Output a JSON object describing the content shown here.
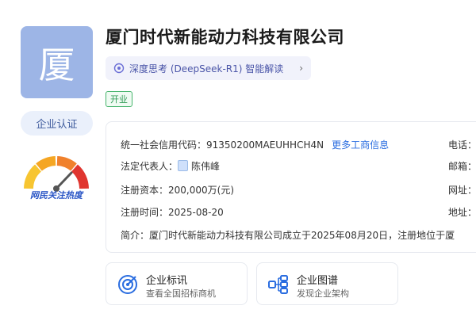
{
  "company": {
    "logo_char": "厦",
    "name": "厦门时代新能动力科技有限公司",
    "status": "开业",
    "cert_label": "企业认证"
  },
  "ai_button": {
    "label": "深度思考 (DeepSeek-R1) 智能解读",
    "chevron": "›"
  },
  "gauge": {
    "label": "网民关注热度",
    "level_fraction": 0.8
  },
  "info": {
    "credit_code_label": "统一社会信用代码：",
    "credit_code": "91350200MAEUHHCH4N",
    "more_link": "更多工商信息",
    "legal_rep_label": "法定代表人：",
    "legal_rep": "陈伟峰",
    "capital_label": "注册资本：",
    "capital": "200,000万(元)",
    "reg_date_label": "注册时间：",
    "reg_date": "2025-08-20",
    "intro_label": "简介：",
    "intro": "厦门时代新能动力科技有限公司成立于2025年08月20日，注册地位于厦",
    "right_labels": [
      "电话：",
      "邮箱：",
      "网址：",
      "地址："
    ]
  },
  "cards": [
    {
      "title": "企业标讯",
      "subtitle": "查看全国招标商机",
      "icon": "target-icon"
    },
    {
      "title": "企业图谱",
      "subtitle": "发现企业架构",
      "icon": "org-chart-icon"
    }
  ],
  "colors": {
    "accent": "#2a6de0",
    "logo_bg": "#9db5e6",
    "status_green": "#2f9b55"
  }
}
